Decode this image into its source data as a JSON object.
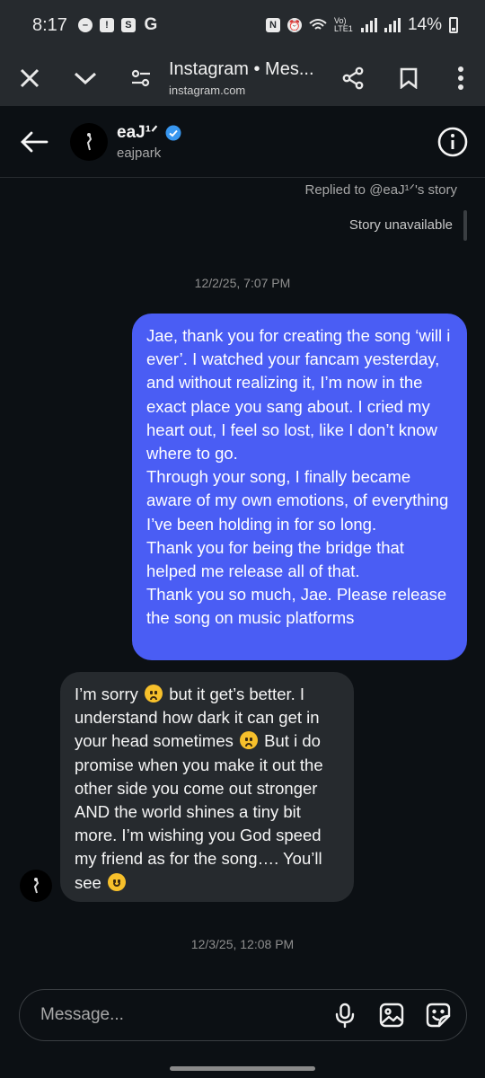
{
  "status_bar": {
    "time": "8:17",
    "battery": "14%",
    "network": "Vo) LTE1",
    "left_icons": [
      "minus-circle-icon",
      "exclamation-icon",
      "shopping-bag-icon",
      "google-icon"
    ],
    "right_icons": [
      "nfc-icon",
      "alarm-icon",
      "wifi-icon",
      "signal-icon",
      "signal-icon",
      "battery-icon"
    ]
  },
  "browser": {
    "title": "Instagram • Mes...",
    "domain": "instagram.com",
    "icons": [
      "close-icon",
      "chevron-down-icon",
      "tune-icon",
      "share-icon",
      "bookmark-icon",
      "more-vert-icon"
    ]
  },
  "chat_header": {
    "name": "eaJ¹ᐟ",
    "username": "eajpark",
    "verified": true,
    "verified_color": "#3897f0"
  },
  "messages": {
    "reply_note": "Replied to @eaJ¹ᐟ's story",
    "story_unavailable": "Story unavailable",
    "timestamp_1": "12/2/25, 7:07 PM",
    "outgoing_text": "Jae, thank you for creating the song ‘will i ever’. I watched your fancam yesterday, and without realizing it, I’m now in the exact place you sang about. I cried my heart out, I feel so lost, like I don’t know where to go.\nThrough your song, I finally became aware of my own emotions, of everything I’ve been holding in for so long.\nThank you for being the bridge that helped me release all of that.\nThank you so much, Jae. Please release the song on music platforms",
    "incoming_parts": {
      "p1": "I’m sorry ",
      "p2": " but it get’s better. I understand how dark it can get in your head sometimes ",
      "p3": " But i do promise when you make it out the other side you come out stronger AND the world shines a tiny bit more. I’m wishing you God speed my friend as for the song…. You’ll see "
    },
    "timestamp_2": "12/3/25, 12:08 PM",
    "outgoing_color": "#4a5df4",
    "incoming_color": "#262a2e"
  },
  "composer": {
    "placeholder": "Message...",
    "icons": [
      "microphone-icon",
      "image-icon",
      "sticker-icon"
    ]
  }
}
